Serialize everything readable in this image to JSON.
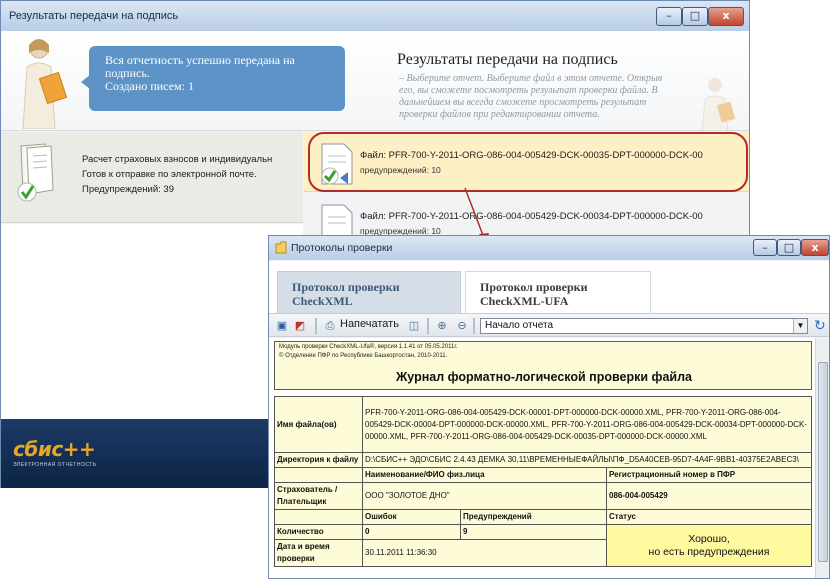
{
  "main_window": {
    "title": "Результаты передачи на подпись",
    "controls": {
      "minimize": "–",
      "maximize": "□",
      "close": "x"
    },
    "bubble": {
      "line1": "Вся отчетность успешно передана на",
      "line2": "подпись.",
      "line3": "Создано писем: 1"
    },
    "heading": "Результаты передачи на подпись",
    "hint": "– Выберите отчет. Выберите файл в этом отчете. Открыв его, вы сможете посмотреть результат проверки файла. В дальнейшем вы всегда сможете просмотреть результат проверки файлов при редактировании отчета.",
    "report": {
      "line1": "Расчет страховых взносов и индивидуальн",
      "line2": "Готов к отправке по электронной почте.",
      "line3": "Предупреждений: 39"
    },
    "files": [
      {
        "name": "Файл: PFR-700-Y-2011-ORG-086-004-005429-DCK-00035-DPT-000000-DCK-00",
        "warnings": "предупреждений: 10"
      },
      {
        "name": "Файл: PFR-700-Y-2011-ORG-086-004-005429-DCK-00034-DPT-000000-DCK-00",
        "warnings": "предупреждений: 10"
      }
    ],
    "logo": {
      "text": "сбис++",
      "subtitle": "ЭЛЕКТРОННАЯ ОТЧЕТНОСТЬ"
    }
  },
  "protocol_window": {
    "title": "Протоколы проверки",
    "controls": {
      "minimize": "–",
      "maximize": "□",
      "close": "x"
    },
    "tabs": [
      {
        "line1": "Протокол проверки",
        "line2": "CheckXML"
      },
      {
        "line1": "Протокол проверки",
        "line2": "CheckXML-UFA"
      }
    ],
    "toolbar": {
      "print_label": "Напечатать",
      "nav_value": "Начало отчета"
    },
    "report": {
      "module_line1": "Модуль проверки CheckXML-Ufa®, версия 1.1.41 от 05.05.2011г.",
      "module_line2": "© Отделение ПФР по Республике Башкортостан, 2010-2011.",
      "journal_title": "Журнал форматно-логической проверки файла",
      "file_names_label": "Имя файла(ов)",
      "file_names_value": "PFR-700-Y-2011-ORG-086-004-005429-DCK-00001-DPT-000000-DCK-00000.XML, PFR-700-Y-2011-ORG-086-004-005429-DCK-00004-DPT-000000-DCK-00000.XML, PFR-700-Y-2011-ORG-086-004-005429-DCK-00034-DPT-000000-DCK-00000.XML, PFR-700-Y-2011-ORG-086-004-005429-DCK-00035-DPT-000000-DCK-00000.XML",
      "dir_label": "Директория к файлу",
      "dir_value": "D:\\СБИС++ ЭДО\\СБИС 2.4.43 ДЕМКА 30,11\\ВРЕМЕННЫЕФАЙЛЫ\\ПФ_D5A40CEB-95D7-4A4F-9BB1-40375E2ABEC3\\",
      "name_header": "Наименование/ФИО физ.лица",
      "reg_header": "Регистрационный номер в ПФР",
      "insurer_label": "Страхователь / Плательщик",
      "insurer_name": "ООО \"ЗОЛОТОЕ ДНО\"",
      "insurer_reg": "086-004-005429",
      "errors_header": "Ошибок",
      "warnings_header": "Предупреждений",
      "status_header": "Статус",
      "count_label": "Количество",
      "errors_count": "0",
      "warnings_count": "9",
      "datetime_label": "Дата и время проверки",
      "datetime_value": "30.11.2011 11:36:30",
      "status_line1": "Хорошо,",
      "status_line2": "но есть предупреждения"
    }
  }
}
